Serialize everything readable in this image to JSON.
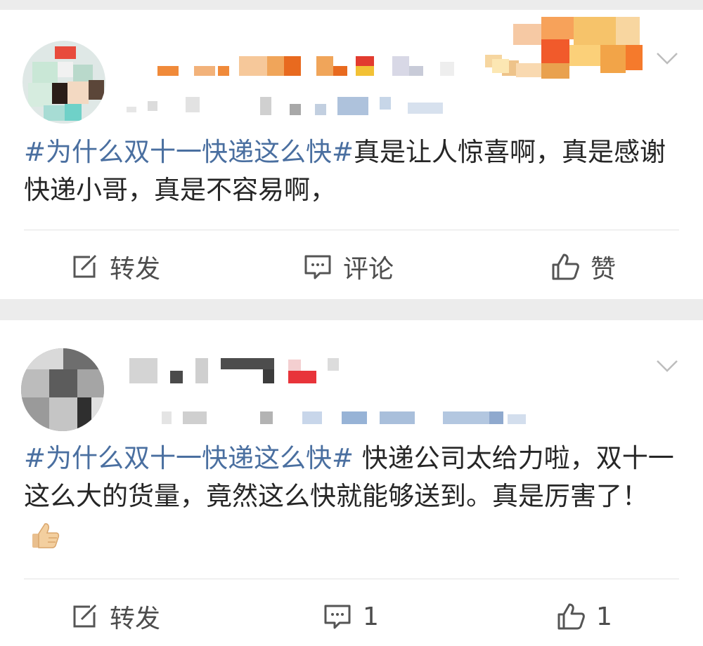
{
  "posts": [
    {
      "text_topic": "#为什么双十一快递这么快#",
      "text_body": "真是让人惊喜啊，真是感谢快递小哥，真是不容易啊，",
      "actions": {
        "repost": "转发",
        "comment": "评论",
        "like": "赞"
      }
    },
    {
      "text_topic": "#为什么双十一快递这么快#",
      "text_body": " 快递公司太给力啦，双十一这么大的货量，竟然这么快就能够送到。真是厉害了！",
      "actions": {
        "repost": "转发",
        "comment": "1",
        "like": "1"
      }
    }
  ],
  "icons": {
    "more": "chevron-down-icon",
    "repost": "share-edit-icon",
    "comment": "comment-bubble-icon",
    "like": "thumbs-up-icon",
    "emoji": "thumbs-up-emoji-icon"
  },
  "colors": {
    "topic": "#4a6fa0",
    "page_bg": "#ececec",
    "card_bg": "#ffffff"
  }
}
